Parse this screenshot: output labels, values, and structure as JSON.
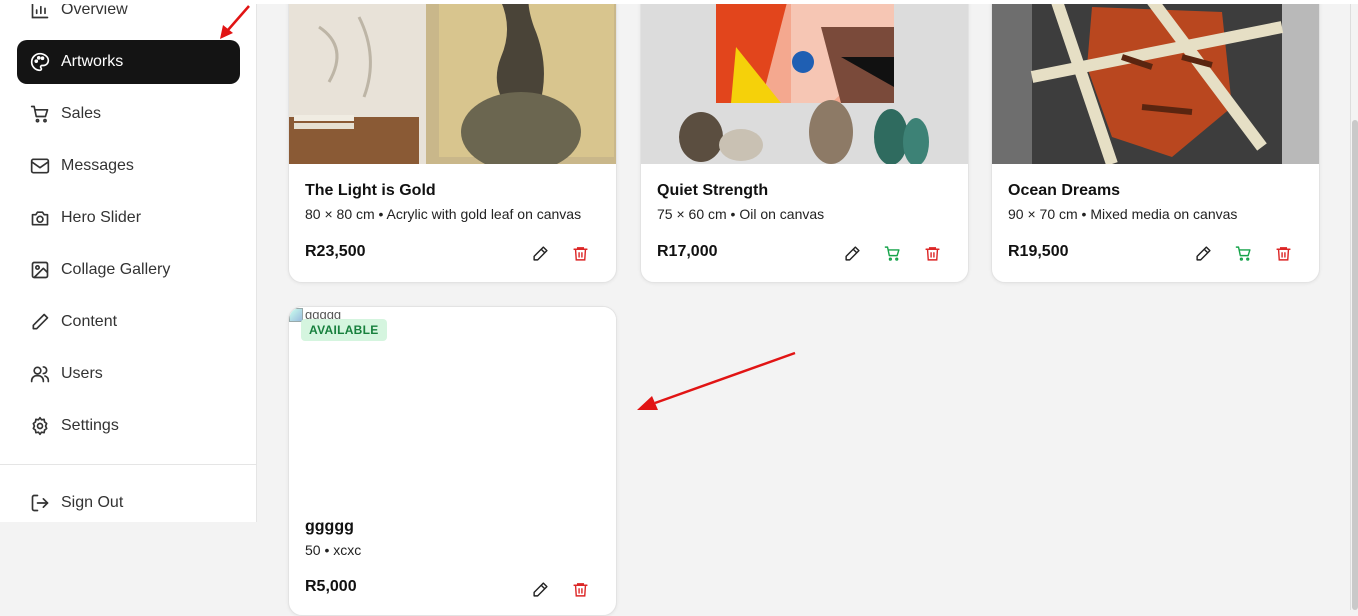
{
  "sidebar": {
    "items": [
      {
        "label": "Overview",
        "icon": "bar-chart-icon"
      },
      {
        "label": "Artworks",
        "icon": "palette-icon",
        "active": true
      },
      {
        "label": "Sales",
        "icon": "cart-icon"
      },
      {
        "label": "Messages",
        "icon": "mail-icon"
      },
      {
        "label": "Hero Slider",
        "icon": "camera-icon"
      },
      {
        "label": "Collage Gallery",
        "icon": "image-icon"
      },
      {
        "label": "Content",
        "icon": "pen-icon"
      },
      {
        "label": "Users",
        "icon": "users-icon"
      },
      {
        "label": "Settings",
        "icon": "gear-icon"
      }
    ],
    "sign_out": {
      "label": "Sign Out",
      "icon": "sign-out-icon"
    }
  },
  "artworks": [
    {
      "title": "The Light is Gold",
      "meta": "80 × 80 cm • Acrylic with gold leaf on canvas",
      "price": "R23,500",
      "sell_action": false
    },
    {
      "title": "Quiet Strength",
      "meta": "75 × 60 cm • Oil on canvas",
      "price": "R17,000",
      "sell_action": true
    },
    {
      "title": "Ocean Dreams",
      "meta": "90 × 70 cm • Mixed media on canvas",
      "price": "R19,500",
      "sell_action": true
    },
    {
      "title": "ggggg",
      "meta": "50 • xcxc",
      "price": "R5,000",
      "sell_action": false,
      "badge": "AVAILABLE",
      "image_alt": "ggggg"
    }
  ],
  "colors": {
    "accent_dark": "#141414",
    "edit": "#222222",
    "sell": "#16a34a",
    "delete": "#dc2626",
    "badge_bg": "#d5f5df",
    "badge_text": "#17803d",
    "annotation_arrow": "#e11414"
  }
}
